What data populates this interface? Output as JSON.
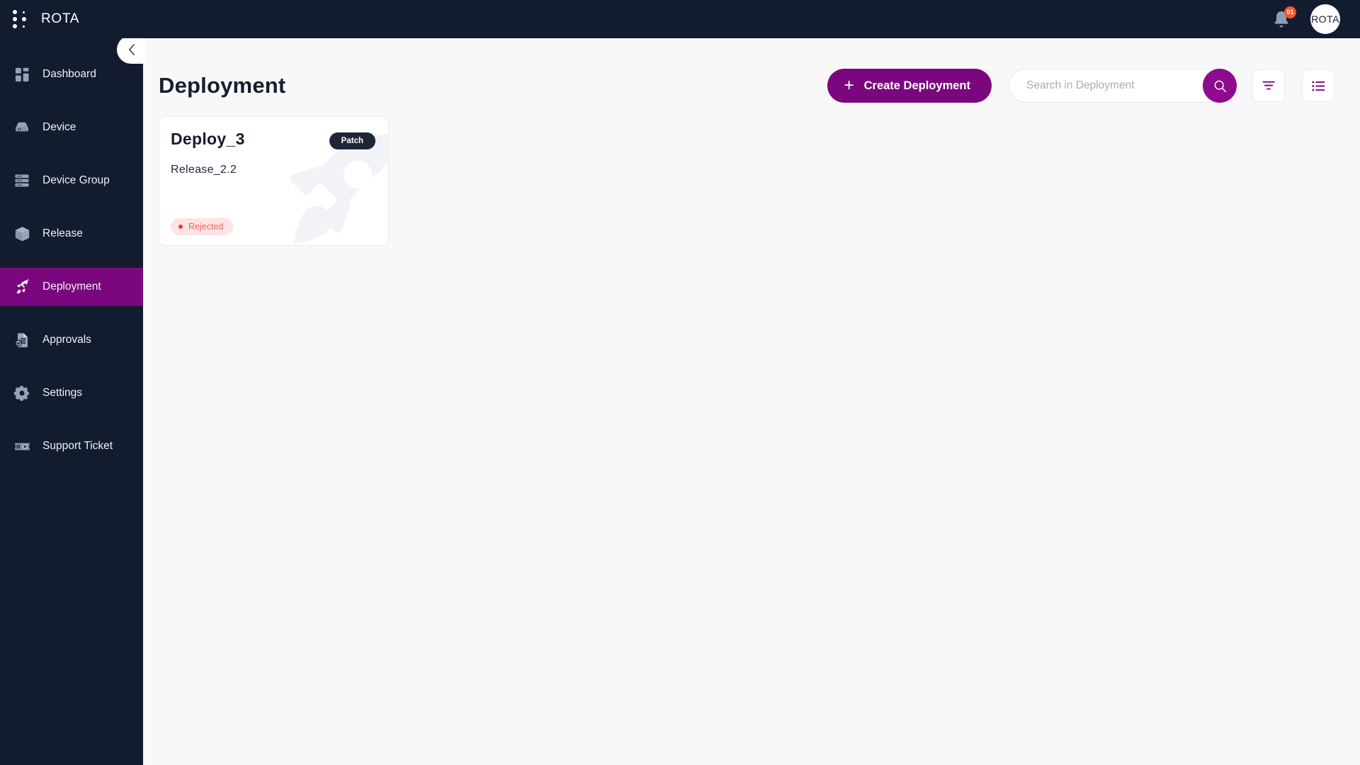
{
  "app": {
    "brand": "ROTA",
    "logo_icon": "dot-grid-logo",
    "accent_purple": "#7b077f",
    "sidebar_bg": "#131c2e",
    "content_bg": "#f8f8f9"
  },
  "topbar": {
    "notifications_icon": "bell-icon",
    "notification_count": "01",
    "avatar_label": "ROTA"
  },
  "sidebar": {
    "collapse_icon": "chevron-left-icon",
    "items": [
      {
        "label": "Dashboard",
        "icon": "dashboard-grid-icon",
        "active": false
      },
      {
        "label": "Device",
        "icon": "server-device-icon",
        "active": false
      },
      {
        "label": "Device Group",
        "icon": "server-stack-icon",
        "active": false
      },
      {
        "label": "Release",
        "icon": "package-box-icon",
        "active": false
      },
      {
        "label": "Deployment",
        "icon": "rocket-icon",
        "active": true
      },
      {
        "label": "Approvals",
        "icon": "document-check-icon",
        "active": false
      },
      {
        "label": "Settings",
        "icon": "gear-icon",
        "active": false
      },
      {
        "label": "Support Ticket",
        "icon": "ticket-icon",
        "active": false
      }
    ]
  },
  "main": {
    "page_title": "Deployment",
    "create_button": {
      "label": "Create Deployment",
      "icon": "plus-icon"
    },
    "search": {
      "value": "",
      "placeholder": "Search in Deployment",
      "icon": "search-icon"
    },
    "filter_button": {
      "icon": "filter-icon"
    },
    "list_view_button": {
      "icon": "list-view-icon"
    }
  },
  "deployments": [
    {
      "name": "Deploy_3",
      "tag": "Patch",
      "release": "Release_2.2",
      "status": "Rejected",
      "status_color": "#f4645f",
      "status_bg": "#fde4e4",
      "watermark_icon": "rocket-watermark-icon"
    }
  ]
}
